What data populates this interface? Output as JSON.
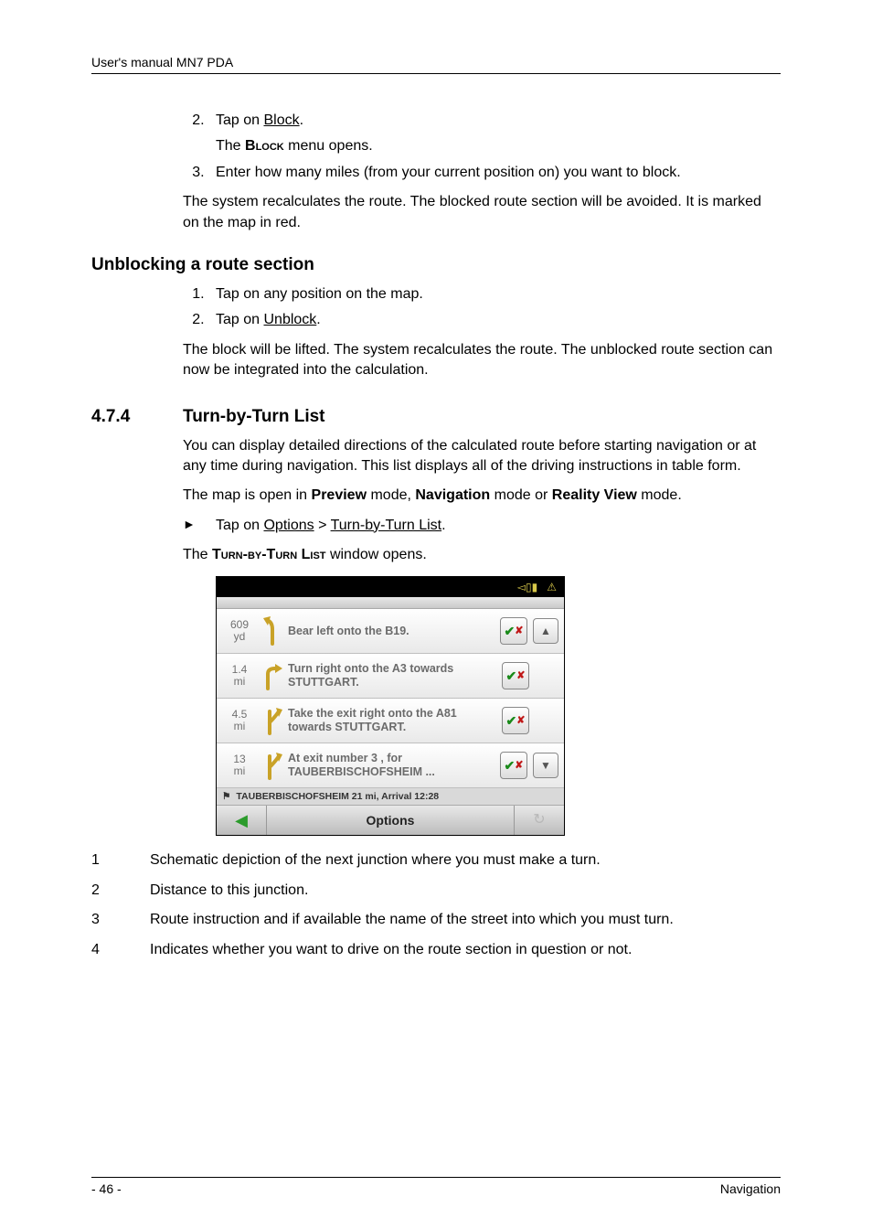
{
  "header": {
    "title": "User's manual MN7 PDA"
  },
  "step_block": {
    "start": 2,
    "s2": "Tap on ",
    "s2_link": "Block",
    "s2_after": ".",
    "s2_sub_pre": "The ",
    "s2_sub_sc": "Block",
    "s2_sub_post": " menu opens.",
    "s3": "Enter how many miles (from your current position on) you want to block.",
    "after": "The system recalculates the route. The blocked route section will be avoided. It is marked on the map in red."
  },
  "unblock": {
    "heading": "Unblocking a route section",
    "s1": "Tap on any position on the map.",
    "s2_pre": "Tap on ",
    "s2_link": "Unblock",
    "s2_post": ".",
    "after": "The block will be lifted. The system recalculates the route. The unblocked route section can now be integrated into the calculation."
  },
  "section": {
    "num": "4.7.4",
    "title": "Turn-by-Turn List",
    "p1": "You can display detailed directions of the calculated route before starting navigation or at any time during navigation. This list displays all of the driving instructions in table form.",
    "p2_pre": "The map is open in ",
    "p2_b1": "Preview",
    "p2_mid1": " mode, ",
    "p2_b2": "Navigation",
    "p2_mid2": " mode or ",
    "p2_b3": "Reality View",
    "p2_post": " mode.",
    "bullet_pre": "Tap on ",
    "bullet_l1": "Options",
    "bullet_mid": " > ",
    "bullet_l2": "Turn-by-Turn List",
    "bullet_post": ".",
    "after_pre": "The ",
    "after_sc": "Turn-by-Turn List",
    "after_post": " window opens."
  },
  "screenshot": {
    "rows": [
      {
        "dist_v": "609",
        "dist_u": "yd",
        "text": "Bear left onto the B19.",
        "updown": "up"
      },
      {
        "dist_v": "1.4",
        "dist_u": "mi",
        "text": "Turn right onto the A3 towards STUTTGART.",
        "updown": ""
      },
      {
        "dist_v": "4.5",
        "dist_u": "mi",
        "text": "Take the exit right onto the A81 towards STUTTGART.",
        "updown": ""
      },
      {
        "dist_v": "13",
        "dist_u": "mi",
        "text": "At exit number 3 , for TAUBERBISCHOFSHEIM ...",
        "updown": "down"
      }
    ],
    "status": "TAUBERBISCHOFSHEIM 21 mi, Arrival 12:28",
    "options": "Options"
  },
  "legend": {
    "r1": "Schematic depiction of the next junction where you must make a turn.",
    "r2": "Distance to this junction.",
    "r3": "Route instruction and if available the name of the street into which you must turn.",
    "r4": "Indicates whether you want to drive on the route section in question or not."
  },
  "footer": {
    "left": "- 46 -",
    "right": "Navigation"
  }
}
